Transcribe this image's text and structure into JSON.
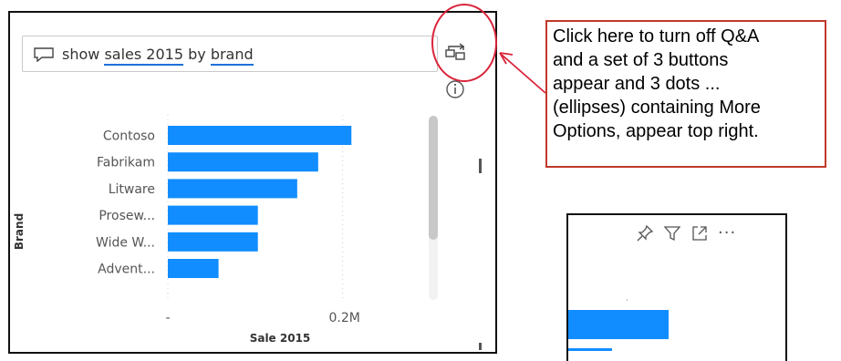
{
  "qa": {
    "query_prefix": "show ",
    "query_kw1": "sales 2015",
    "query_mid": " by ",
    "query_kw2": "brand"
  },
  "callout": {
    "text": "Click here to turn off Q&A\nand a set of 3 buttons\nappear and 3 dots ...\n(ellipses) containing More\nOptions, appear top right."
  },
  "colors": {
    "bar": "#118dff",
    "annotation_red": "#d9243a",
    "underline_blue": "#1e6fd9"
  },
  "icons": {
    "qa_chat": "chat-bubble-icon",
    "turn_off_qa": "turn-into-standard-visual-icon",
    "info": "info-icon",
    "pin": "pin-icon",
    "filter": "filter-icon",
    "focus": "focus-mode-icon",
    "more": "more-options-icon"
  },
  "inset": {
    "ellipsis": "···"
  },
  "chart_data": {
    "type": "bar",
    "orientation": "horizontal",
    "categories": [
      "Contoso",
      "Fabrikam",
      "Litware",
      "Prosew...",
      "Wide W...",
      "Advent..."
    ],
    "values": [
      0.21,
      0.172,
      0.148,
      0.103,
      0.103,
      0.058
    ],
    "xlabel": "Sale 2015",
    "ylabel": "Brand",
    "xticks": [
      "-",
      "0.2M"
    ],
    "xtick_values": [
      0,
      0.2
    ],
    "xlim": [
      0,
      0.24
    ],
    "unit": "M",
    "grid": true
  }
}
